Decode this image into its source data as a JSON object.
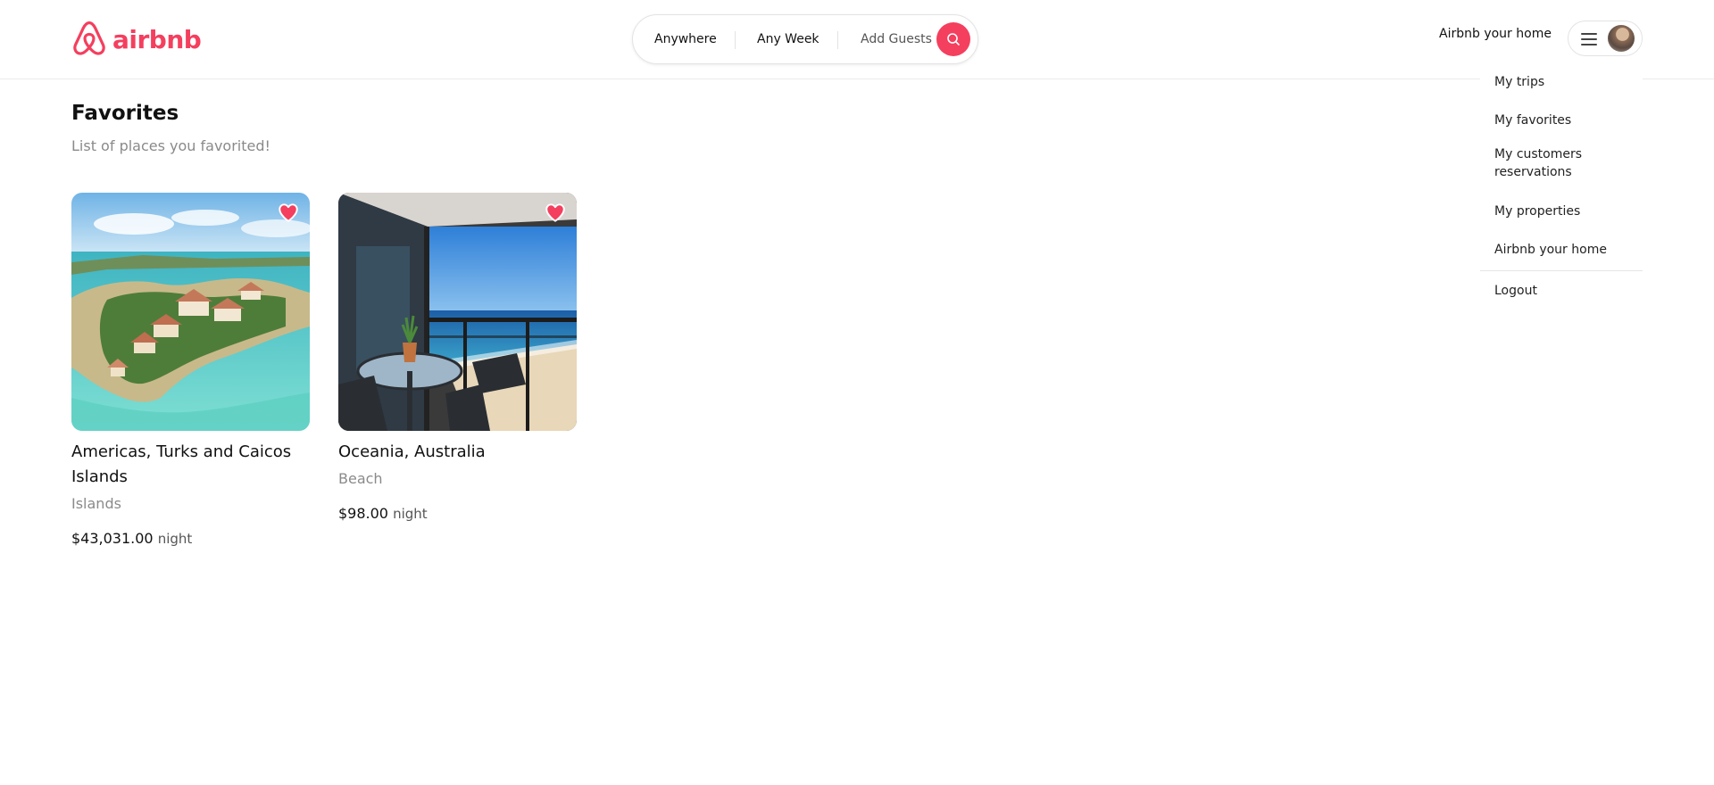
{
  "brand": {
    "name": "airbnb",
    "color": "#f43f5e"
  },
  "search": {
    "where": "Anywhere",
    "when": "Any Week",
    "guests": "Add Guests",
    "button_icon": "search-icon"
  },
  "header": {
    "host_link": "Airbnb your home",
    "menu_icon": "hamburger-icon",
    "avatar": "user-avatar"
  },
  "dropdown": {
    "items": [
      {
        "label": "My trips"
      },
      {
        "label": "My favorites"
      },
      {
        "label": "My customers reservations"
      },
      {
        "label": "My properties"
      },
      {
        "label": "Airbnb your home"
      }
    ],
    "logout": "Logout"
  },
  "main": {
    "title": "Favorites",
    "subtitle": "List of places you favorited!"
  },
  "listings": [
    {
      "title": "Americas, Turks and Caicos Islands",
      "category": "Islands",
      "price": "$43,031.00",
      "unit": "night",
      "favorited": true
    },
    {
      "title": "Oceania, Australia",
      "category": "Beach",
      "price": "$98.00",
      "unit": "night",
      "favorited": true
    }
  ]
}
